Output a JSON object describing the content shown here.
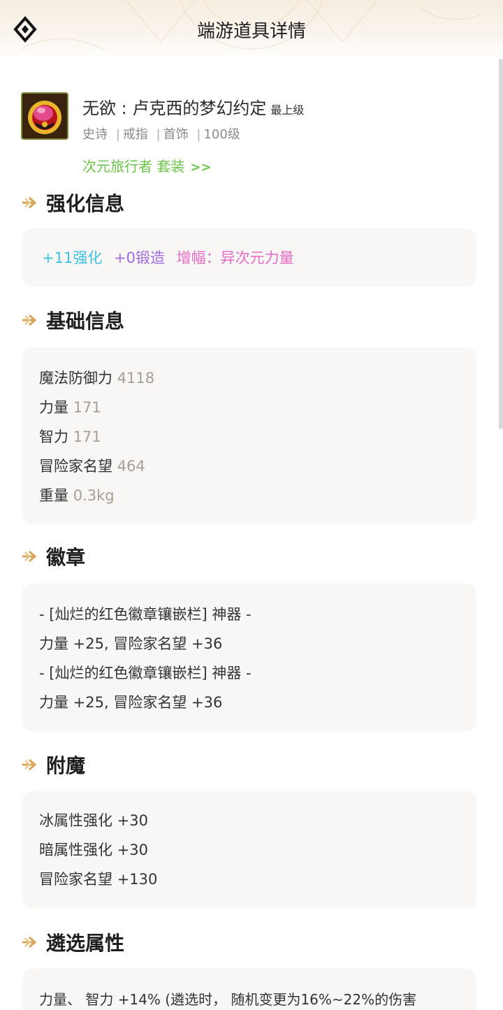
{
  "header": {
    "title": "端游道具详情",
    "back_icon": "back-diamond-icon"
  },
  "item": {
    "name": "无欲 : 卢克西的梦幻约定",
    "level_tag": "最上级",
    "meta": [
      "史诗",
      "戒指",
      "首饰",
      "100级"
    ],
    "meta_separator": "|",
    "set_name": "次元旅行者 套装",
    "set_arrow": ">>",
    "icon": "ring-item-icon"
  },
  "sections": {
    "enhance": {
      "title": "强化信息",
      "reinforce": "+11强化",
      "forge": "+0锻造",
      "amplify": "增幅：异次元力量"
    },
    "basic": {
      "title": "基础信息",
      "rows": [
        {
          "label": "魔法防御力",
          "value": "4118"
        },
        {
          "label": "力量",
          "value": "171"
        },
        {
          "label": "智力",
          "value": "171"
        },
        {
          "label": "冒险家名望",
          "value": "464"
        },
        {
          "label": "重量",
          "value": "0.3kg"
        }
      ]
    },
    "emblem": {
      "title": "徽章",
      "lines": [
        "- [灿烂的红色徽章镶嵌栏] 神器 -",
        "力量 +25, 冒险家名望 +36",
        "- [灿烂的红色徽章镶嵌栏] 神器 -",
        "力量 +25, 冒险家名望 +36"
      ]
    },
    "enchant": {
      "title": "附魔",
      "lines": [
        "冰属性强化 +30",
        "暗属性强化 +30",
        "冒险家名望 +130"
      ]
    },
    "tune": {
      "title": "遴选属性",
      "lines": [
        "力量、 智力 +14% (遴选时， 随机变更为16%~22%的伤害"
      ]
    }
  },
  "colors": {
    "reinforce": "#3fc1e0",
    "forge": "#a06be0",
    "amplify": "#e46bc4",
    "set_link": "#6cc24a",
    "section_arrow": "#d6a65a",
    "value_gray": "#a59f98"
  }
}
